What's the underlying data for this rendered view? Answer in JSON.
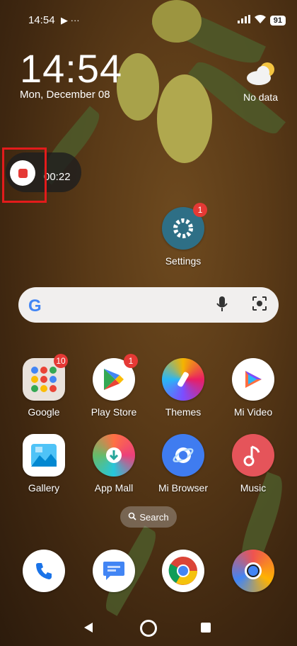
{
  "status_bar": {
    "time": "14:54",
    "left_icons": "▶ ···",
    "battery": "91"
  },
  "lock": {
    "clock": "14:54",
    "date": "Mon, December 08",
    "weather": "No data"
  },
  "recorder": {
    "elapsed": "00:22"
  },
  "settings_app": {
    "label": "Settings",
    "badge": "1"
  },
  "search_widget": {
    "logo": "G"
  },
  "apps_row1": [
    {
      "label": "Google",
      "badge": "10"
    },
    {
      "label": "Play Store",
      "badge": "1"
    },
    {
      "label": "Themes"
    },
    {
      "label": "Mi Video"
    }
  ],
  "apps_row2": [
    {
      "label": "Gallery"
    },
    {
      "label": "App Mall"
    },
    {
      "label": "Mi Browser"
    },
    {
      "label": "Music"
    }
  ],
  "search_pill": {
    "label": "Search"
  },
  "dock": [
    "phone-icon",
    "messages-icon",
    "chrome-icon",
    "chrome-beta-icon"
  ],
  "colors": {
    "badge": "#e53935",
    "record": "#e53935",
    "highlight": "#e31b1b"
  }
}
